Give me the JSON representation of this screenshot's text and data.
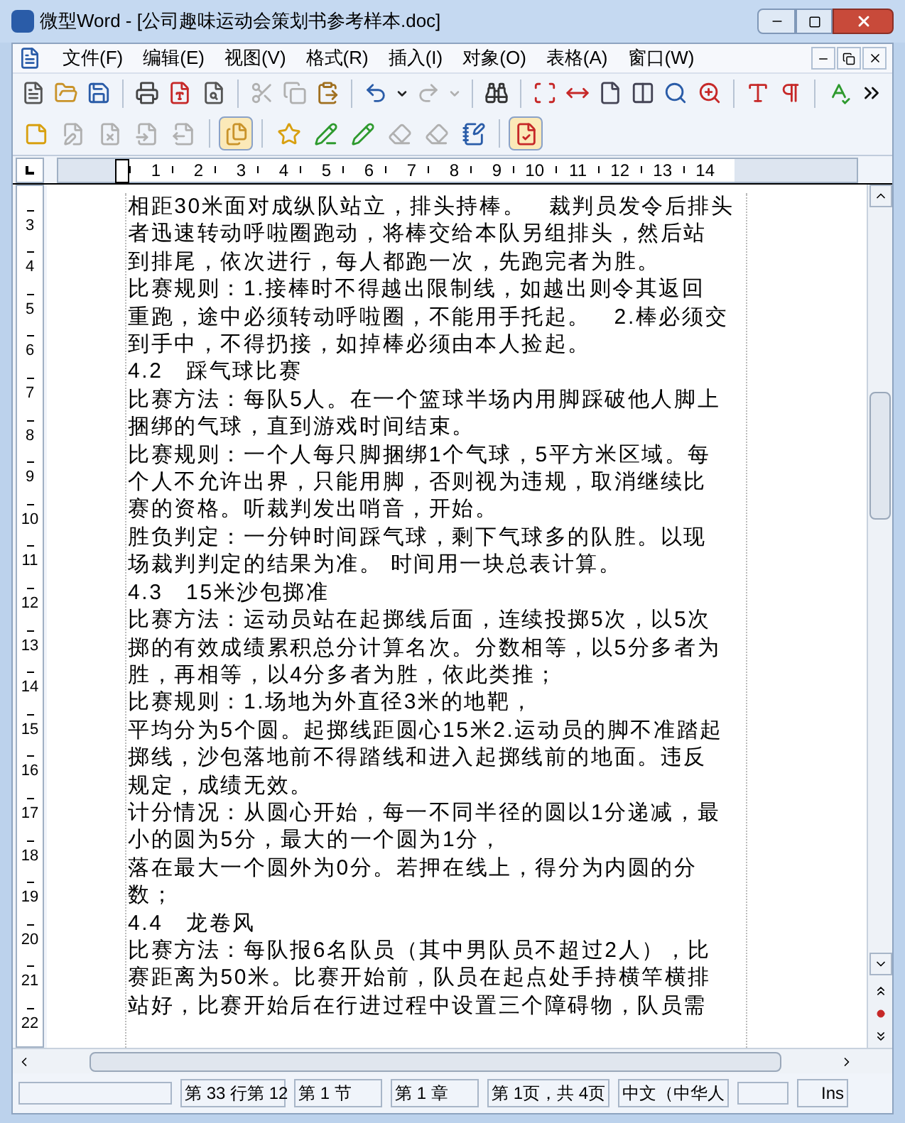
{
  "window": {
    "title": "微型Word - [公司趣味运动会策划书参考样本.doc]"
  },
  "menu": [
    "文件(F)",
    "编辑(E)",
    "视图(V)",
    "格式(R)",
    "插入(I)",
    "对象(O)",
    "表格(A)",
    "窗口(W)"
  ],
  "toolbar": [
    {
      "kind": "new",
      "disabled": false
    },
    {
      "kind": "open",
      "disabled": false
    },
    {
      "kind": "save",
      "disabled": false
    },
    {
      "kind": "separator"
    },
    {
      "kind": "print",
      "disabled": false
    },
    {
      "kind": "pdf",
      "disabled": false
    },
    {
      "kind": "preview",
      "disabled": false
    },
    {
      "kind": "separator"
    },
    {
      "kind": "cut",
      "disabled": true
    },
    {
      "kind": "copy",
      "disabled": true
    },
    {
      "kind": "paste",
      "disabled": false
    },
    {
      "kind": "separator"
    },
    {
      "kind": "undo",
      "disabled": false
    },
    {
      "kind": "dropdown",
      "disabled": false
    },
    {
      "kind": "redo",
      "disabled": true
    },
    {
      "kind": "dropdown",
      "disabled": true
    },
    {
      "kind": "separator"
    },
    {
      "kind": "find",
      "disabled": false
    },
    {
      "kind": "separator"
    },
    {
      "kind": "actual-size",
      "disabled": false
    },
    {
      "kind": "page-width",
      "disabled": false
    },
    {
      "kind": "one-page",
      "disabled": false
    },
    {
      "kind": "two-pages",
      "disabled": false
    },
    {
      "kind": "zoom",
      "disabled": false
    },
    {
      "kind": "zoom-percent",
      "disabled": false
    },
    {
      "kind": "separator"
    },
    {
      "kind": "font",
      "disabled": false
    },
    {
      "kind": "paragraph",
      "disabled": false
    },
    {
      "kind": "separator"
    },
    {
      "kind": "spelling",
      "disabled": false
    },
    {
      "kind": "more",
      "disabled": false
    }
  ],
  "review_toolbar": [
    {
      "kind": "new-comment",
      "disabled": false,
      "pressed": false
    },
    {
      "kind": "edit-comment",
      "disabled": true,
      "pressed": false
    },
    {
      "kind": "delete-comment",
      "disabled": true,
      "pressed": false
    },
    {
      "kind": "prev-comment",
      "disabled": true,
      "pressed": false
    },
    {
      "kind": "next-comment",
      "disabled": true,
      "pressed": false
    },
    {
      "kind": "separator"
    },
    {
      "kind": "show-comments",
      "disabled": false,
      "pressed": true
    },
    {
      "kind": "separator"
    },
    {
      "kind": "mark",
      "disabled": false,
      "pressed": false
    },
    {
      "kind": "accept-prev",
      "disabled": false,
      "pressed": false
    },
    {
      "kind": "accept-next",
      "disabled": false,
      "pressed": false
    },
    {
      "kind": "reject",
      "disabled": true,
      "pressed": false
    },
    {
      "kind": "reject-all",
      "disabled": true,
      "pressed": false
    },
    {
      "kind": "review-pane",
      "disabled": false,
      "pressed": false
    },
    {
      "kind": "separator"
    },
    {
      "kind": "track-changes",
      "disabled": false,
      "pressed": true
    }
  ],
  "ruler": [
    "1",
    "2",
    "3",
    "4",
    "5",
    "6",
    "7",
    "8",
    "9",
    "10",
    "11",
    "12",
    "13",
    "14"
  ],
  "vertical_ruler": [
    "3",
    "4",
    "5",
    "6",
    "7",
    "8",
    "9",
    "10",
    "11",
    "12",
    "13",
    "14",
    "15",
    "16",
    "17",
    "18",
    "19",
    "20",
    "21",
    "22"
  ],
  "document": {
    "lines": [
      "相距30米面对成纵队站立，排头持棒。　裁判员发令后排头",
      "者迅速转动呼啦圈跑动，将棒交给本队另组排头，然后站",
      "到排尾，依次进行，每人都跑一次，先跑完者为胜。",
      "比赛规则：1.接棒时不得越出限制线，如越出则令其返回",
      "重跑，途中必须转动呼啦圈，不能用手托起。　2.棒必须交",
      "到手中，不得扔接，如掉棒必须由本人捡起。",
      "4.2　踩气球比赛",
      "比赛方法：每队5人。在一个篮球半场内用脚踩破他人脚上",
      "捆绑的气球，直到游戏时间结束。",
      "比赛规则：一个人每只脚捆绑1个气球，5平方米区域。每",
      "个人不允许出界，只能用脚，否则视为违规，取消继续比",
      "赛的资格。听裁判发出哨音，开始。",
      "胜负判定：一分钟时间踩气球，剩下气球多的队胜。以现",
      "场裁判判定的结果为准。 时间用一块总表计算。",
      "4.3　15米沙包掷准",
      "比赛方法：运动员站在起掷线后面，连续投掷5次，以5次",
      "掷的有效成绩累积总分计算名次。分数相等，以5分多者为",
      "胜，再相等，以4分多者为胜，依此类推；",
      "比赛规则：1.场地为外直径3米的地靶，",
      "平均分为5个圆。起掷线距圆心15米2.运动员的脚不准踏起",
      "掷线，沙包落地前不得踏线和进入起掷线前的地面。违反",
      "规定，成绩无效。",
      "计分情况：从圆心开始，每一不同半径的圆以1分递减，最",
      "小的圆为5分，最大的一个圆为1分，",
      "落在最大一个圆外为0分。若押在线上，得分为内圆的分",
      "数；",
      "4.4　龙卷风",
      "比赛方法：每队报6名队员（其中男队员不超过2人），比",
      "赛距离为50米。比赛开始前，队员在起点处手持横竿横排",
      "站好，比赛开始后在行进过程中设置三个障碍物，队员需"
    ]
  },
  "status_bar": {
    "position": "第 33 行第 12",
    "section": "第 1 节",
    "chapter": "第 1 章",
    "page": "第 1页，共 4页",
    "language": "中文（中华人",
    "mode": "Ins"
  }
}
